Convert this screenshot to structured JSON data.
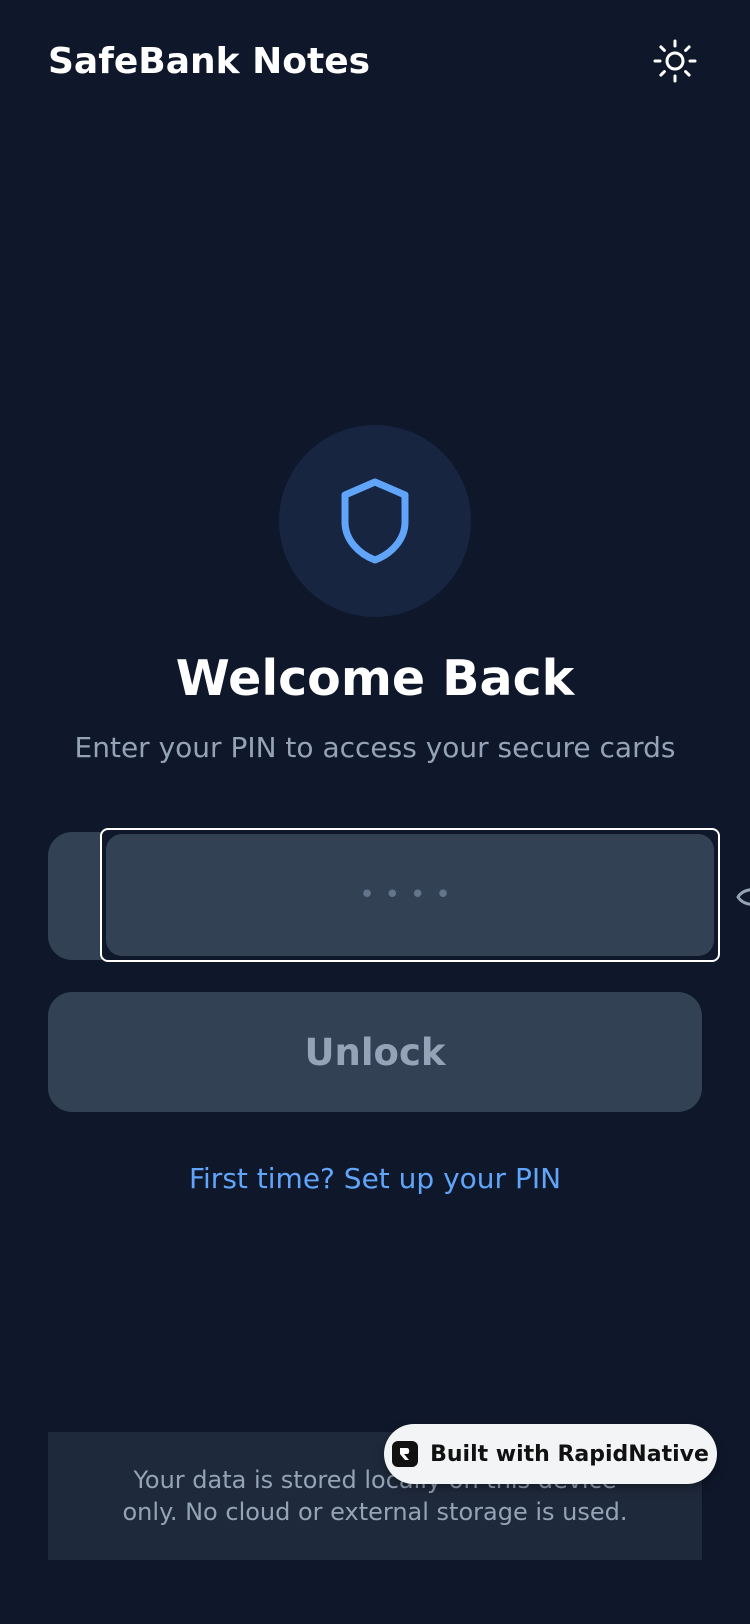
{
  "header": {
    "title": "SafeBank Notes",
    "theme_icon": "sun-icon"
  },
  "lock_screen": {
    "icon": "shield-icon",
    "title": "Welcome Back",
    "subtitle": "Enter your PIN to access your secure cards",
    "pin_input": {
      "value": "",
      "placeholder": "••••"
    },
    "visibility_icon": "eye-icon",
    "unlock_label": "Unlock",
    "setup_link": "First time? Set up your PIN"
  },
  "footer": {
    "note": "Your data is stored locally on this device only. No cloud or external storage is used."
  },
  "badge": {
    "label": "Built with RapidNative",
    "icon": "rapidnative-logo-icon"
  },
  "colors": {
    "background": "#0f172a",
    "surface": "#334155",
    "accent": "#60a5fa",
    "muted_text": "#94a3b8"
  }
}
